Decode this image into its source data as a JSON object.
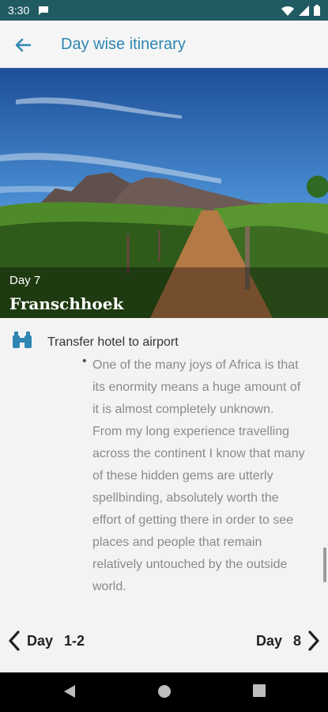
{
  "status": {
    "time": "3:30"
  },
  "app_bar": {
    "title": "Day wise itinerary"
  },
  "hero": {
    "day_label": "Day 7",
    "place": "Franschhoek"
  },
  "activity": {
    "title": "Transfer hotel to airport",
    "bullet": "•",
    "description": "One of the many joys of Africa is that its enormity means a huge amount of it is almost completely unknown. From my long experience travelling across the continent I know that many of these hidden gems are utterly spellbinding, absolutely worth the effort of getting there in order to see places and people that remain relatively untouched by the outside world."
  },
  "nav": {
    "prev_label": "Day",
    "prev_value": "1-2",
    "next_label": "Day",
    "next_value": "8"
  },
  "colors": {
    "status_bar": "#1f5b61",
    "accent": "#2f86b3"
  },
  "icons": [
    "chat-icon",
    "wifi-icon",
    "signal-icon",
    "battery-icon",
    "back-arrow-icon",
    "binoculars-icon",
    "chevron-left-icon",
    "chevron-right-icon",
    "back-triangle-icon",
    "home-circle-icon",
    "recents-square-icon"
  ]
}
